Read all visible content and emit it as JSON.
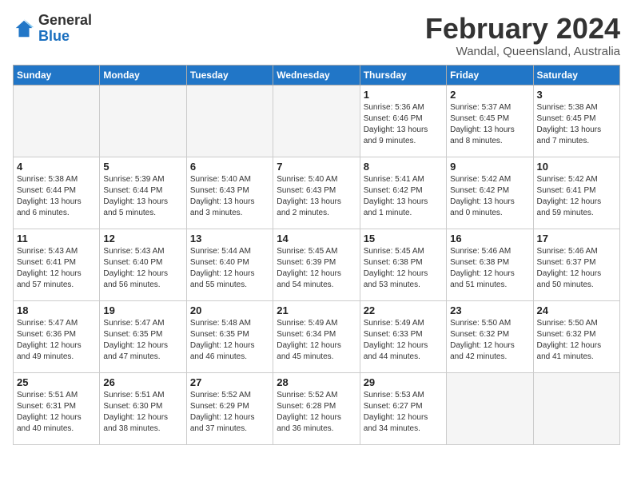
{
  "header": {
    "logo_general": "General",
    "logo_blue": "Blue",
    "month_title": "February 2024",
    "location": "Wandal, Queensland, Australia"
  },
  "days_of_week": [
    "Sunday",
    "Monday",
    "Tuesday",
    "Wednesday",
    "Thursday",
    "Friday",
    "Saturday"
  ],
  "weeks": [
    [
      {
        "day": "",
        "info": ""
      },
      {
        "day": "",
        "info": ""
      },
      {
        "day": "",
        "info": ""
      },
      {
        "day": "",
        "info": ""
      },
      {
        "day": "1",
        "info": "Sunrise: 5:36 AM\nSunset: 6:46 PM\nDaylight: 13 hours\nand 9 minutes."
      },
      {
        "day": "2",
        "info": "Sunrise: 5:37 AM\nSunset: 6:45 PM\nDaylight: 13 hours\nand 8 minutes."
      },
      {
        "day": "3",
        "info": "Sunrise: 5:38 AM\nSunset: 6:45 PM\nDaylight: 13 hours\nand 7 minutes."
      }
    ],
    [
      {
        "day": "4",
        "info": "Sunrise: 5:38 AM\nSunset: 6:44 PM\nDaylight: 13 hours\nand 6 minutes."
      },
      {
        "day": "5",
        "info": "Sunrise: 5:39 AM\nSunset: 6:44 PM\nDaylight: 13 hours\nand 5 minutes."
      },
      {
        "day": "6",
        "info": "Sunrise: 5:40 AM\nSunset: 6:43 PM\nDaylight: 13 hours\nand 3 minutes."
      },
      {
        "day": "7",
        "info": "Sunrise: 5:40 AM\nSunset: 6:43 PM\nDaylight: 13 hours\nand 2 minutes."
      },
      {
        "day": "8",
        "info": "Sunrise: 5:41 AM\nSunset: 6:42 PM\nDaylight: 13 hours\nand 1 minute."
      },
      {
        "day": "9",
        "info": "Sunrise: 5:42 AM\nSunset: 6:42 PM\nDaylight: 13 hours\nand 0 minutes."
      },
      {
        "day": "10",
        "info": "Sunrise: 5:42 AM\nSunset: 6:41 PM\nDaylight: 12 hours\nand 59 minutes."
      }
    ],
    [
      {
        "day": "11",
        "info": "Sunrise: 5:43 AM\nSunset: 6:41 PM\nDaylight: 12 hours\nand 57 minutes."
      },
      {
        "day": "12",
        "info": "Sunrise: 5:43 AM\nSunset: 6:40 PM\nDaylight: 12 hours\nand 56 minutes."
      },
      {
        "day": "13",
        "info": "Sunrise: 5:44 AM\nSunset: 6:40 PM\nDaylight: 12 hours\nand 55 minutes."
      },
      {
        "day": "14",
        "info": "Sunrise: 5:45 AM\nSunset: 6:39 PM\nDaylight: 12 hours\nand 54 minutes."
      },
      {
        "day": "15",
        "info": "Sunrise: 5:45 AM\nSunset: 6:38 PM\nDaylight: 12 hours\nand 53 minutes."
      },
      {
        "day": "16",
        "info": "Sunrise: 5:46 AM\nSunset: 6:38 PM\nDaylight: 12 hours\nand 51 minutes."
      },
      {
        "day": "17",
        "info": "Sunrise: 5:46 AM\nSunset: 6:37 PM\nDaylight: 12 hours\nand 50 minutes."
      }
    ],
    [
      {
        "day": "18",
        "info": "Sunrise: 5:47 AM\nSunset: 6:36 PM\nDaylight: 12 hours\nand 49 minutes."
      },
      {
        "day": "19",
        "info": "Sunrise: 5:47 AM\nSunset: 6:35 PM\nDaylight: 12 hours\nand 47 minutes."
      },
      {
        "day": "20",
        "info": "Sunrise: 5:48 AM\nSunset: 6:35 PM\nDaylight: 12 hours\nand 46 minutes."
      },
      {
        "day": "21",
        "info": "Sunrise: 5:49 AM\nSunset: 6:34 PM\nDaylight: 12 hours\nand 45 minutes."
      },
      {
        "day": "22",
        "info": "Sunrise: 5:49 AM\nSunset: 6:33 PM\nDaylight: 12 hours\nand 44 minutes."
      },
      {
        "day": "23",
        "info": "Sunrise: 5:50 AM\nSunset: 6:32 PM\nDaylight: 12 hours\nand 42 minutes."
      },
      {
        "day": "24",
        "info": "Sunrise: 5:50 AM\nSunset: 6:32 PM\nDaylight: 12 hours\nand 41 minutes."
      }
    ],
    [
      {
        "day": "25",
        "info": "Sunrise: 5:51 AM\nSunset: 6:31 PM\nDaylight: 12 hours\nand 40 minutes."
      },
      {
        "day": "26",
        "info": "Sunrise: 5:51 AM\nSunset: 6:30 PM\nDaylight: 12 hours\nand 38 minutes."
      },
      {
        "day": "27",
        "info": "Sunrise: 5:52 AM\nSunset: 6:29 PM\nDaylight: 12 hours\nand 37 minutes."
      },
      {
        "day": "28",
        "info": "Sunrise: 5:52 AM\nSunset: 6:28 PM\nDaylight: 12 hours\nand 36 minutes."
      },
      {
        "day": "29",
        "info": "Sunrise: 5:53 AM\nSunset: 6:27 PM\nDaylight: 12 hours\nand 34 minutes."
      },
      {
        "day": "",
        "info": ""
      },
      {
        "day": "",
        "info": ""
      }
    ]
  ]
}
